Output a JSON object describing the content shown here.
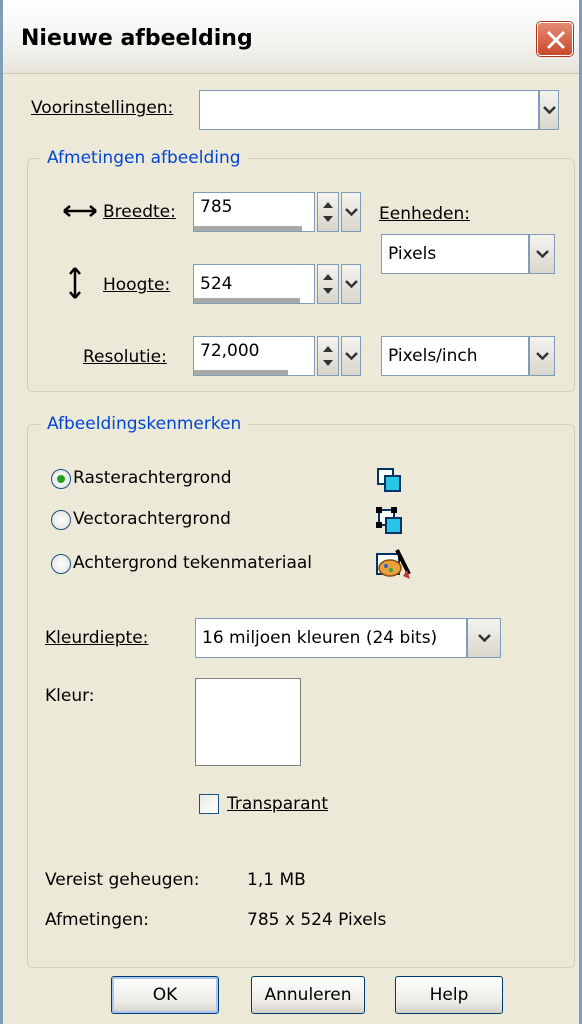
{
  "dialog": {
    "title": "Nieuwe afbeelding"
  },
  "presets": {
    "label": "Voorinstellingen:",
    "value": ""
  },
  "dimensions": {
    "group_title": "Afmetingen afbeelding",
    "width_label": "Breedte:",
    "width_value": "785",
    "height_label": "Hoogte:",
    "height_value": "524",
    "resolution_label": "Resolutie:",
    "resolution_value": "72,000",
    "units_label": "Eenheden:",
    "units_value": "Pixels",
    "res_units_value": "Pixels/inch"
  },
  "characteristics": {
    "group_title": "Afbeeldingskenmerken",
    "options": [
      {
        "label": "Rasterachtergrond",
        "selected": true,
        "icon": "raster-layer-icon"
      },
      {
        "label": "Vectorachtergrond",
        "selected": false,
        "icon": "vector-layer-icon"
      },
      {
        "label": "Achtergrond tekenmateriaal",
        "selected": false,
        "icon": "art-media-icon"
      }
    ],
    "color_depth_label": "Kleurdiepte:",
    "color_depth_value": "16 miljoen kleuren (24 bits)",
    "color_label": "Kleur:",
    "color_value": "#ffffff",
    "transparent_label": "Transparant",
    "transparent_checked": false
  },
  "info": {
    "memory_label": "Vereist geheugen:",
    "memory_value": "1,1 MB",
    "size_label": "Afmetingen:",
    "size_value": "785 x 524 Pixels"
  },
  "buttons": {
    "ok": "OK",
    "cancel": "Annuleren",
    "help": "Help"
  }
}
